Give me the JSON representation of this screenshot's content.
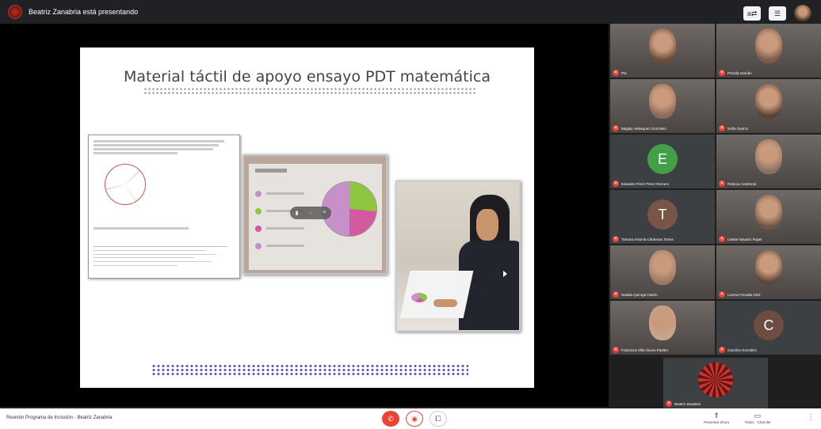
{
  "header": {
    "presenter_label": "Beatriz Zanabria está presentando",
    "layout_icon_label": "a⇄",
    "pin_icon_label": "☰"
  },
  "slide": {
    "title": "Material táctil de apoyo ensayo PDT matemática",
    "overlay_controls": [
      "▮",
      "◌",
      "⌗"
    ]
  },
  "participants": [
    {
      "name": "Pia",
      "kind": "photo",
      "color": "#6a4a3a"
    },
    {
      "name": "Priscila Garrido",
      "kind": "photo",
      "color": "#7a5a48"
    },
    {
      "name": "Magaly Velasquez Gonzalez",
      "kind": "photo",
      "color": "#8a6a58"
    },
    {
      "name": "Sofía Oyarzo",
      "kind": "photo",
      "color": "#5a4236"
    },
    {
      "name": "Eduardo Pérez Pérez Romero",
      "kind": "letter",
      "letter": "E",
      "color": "#43a047"
    },
    {
      "name": "Rebeca Contreras",
      "kind": "photo",
      "color": "#8d7060"
    },
    {
      "name": "Tamara Antonia Cárdenas Torres",
      "kind": "letter",
      "letter": "T",
      "color": "#795548"
    },
    {
      "name": "Lisette Navarro Rojas",
      "kind": "photo",
      "color": "#6d5547"
    },
    {
      "name": "Natalia Quiroga Castro",
      "kind": "photo",
      "color": "#9b7a66"
    },
    {
      "name": "Lorena Ferrada Ortiz",
      "kind": "photo",
      "color": "#5e4639"
    },
    {
      "name": "Francisca Villa Osorio Pastén",
      "kind": "photo",
      "color": "#c8a58c"
    },
    {
      "name": "Carolina González",
      "kind": "letter",
      "letter": "C",
      "color": "#6d4c41"
    },
    {
      "name": "Beatriz Zanabria",
      "kind": "logo",
      "color": "#b71c1c"
    }
  ],
  "bottom": {
    "meeting_name": "Reunión Programa de Inclusión - Beatriz Zanabria",
    "hangup_icon": "✆",
    "mic_icon": "◉",
    "camera_icon": "⧠",
    "present_label": "Presentar ahora",
    "chat_label": "Todos · Chat del",
    "more_icon": "⋮"
  },
  "colors": {
    "accent_red": "#ea4335",
    "stage_bg": "#000000",
    "panel_bg": "#3c4043"
  }
}
